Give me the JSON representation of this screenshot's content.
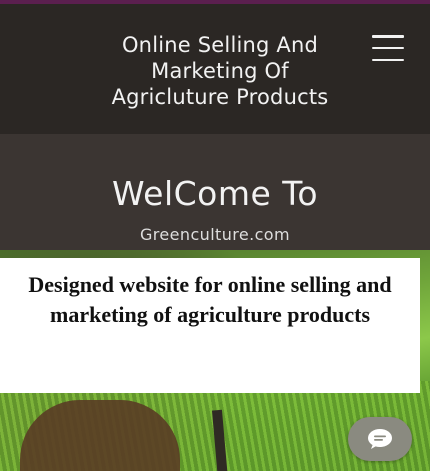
{
  "header": {
    "brand_title": "Online Selling And\nMarketing Of\nAgricluture Products",
    "menu_icon": "hamburger-menu-icon"
  },
  "hero": {
    "welcome_text": "WelCome To",
    "site_name": "Greenculture.com"
  },
  "caption": {
    "text": "Designed website for online selling and marketing of agriculture products"
  },
  "chat": {
    "icon": "chat-bubble-icon"
  },
  "colors": {
    "top_border": "#5b1f4f",
    "header_bg": "#2b2724",
    "hero_bg": "#3b3532",
    "chat_button": "#8a8a80"
  }
}
